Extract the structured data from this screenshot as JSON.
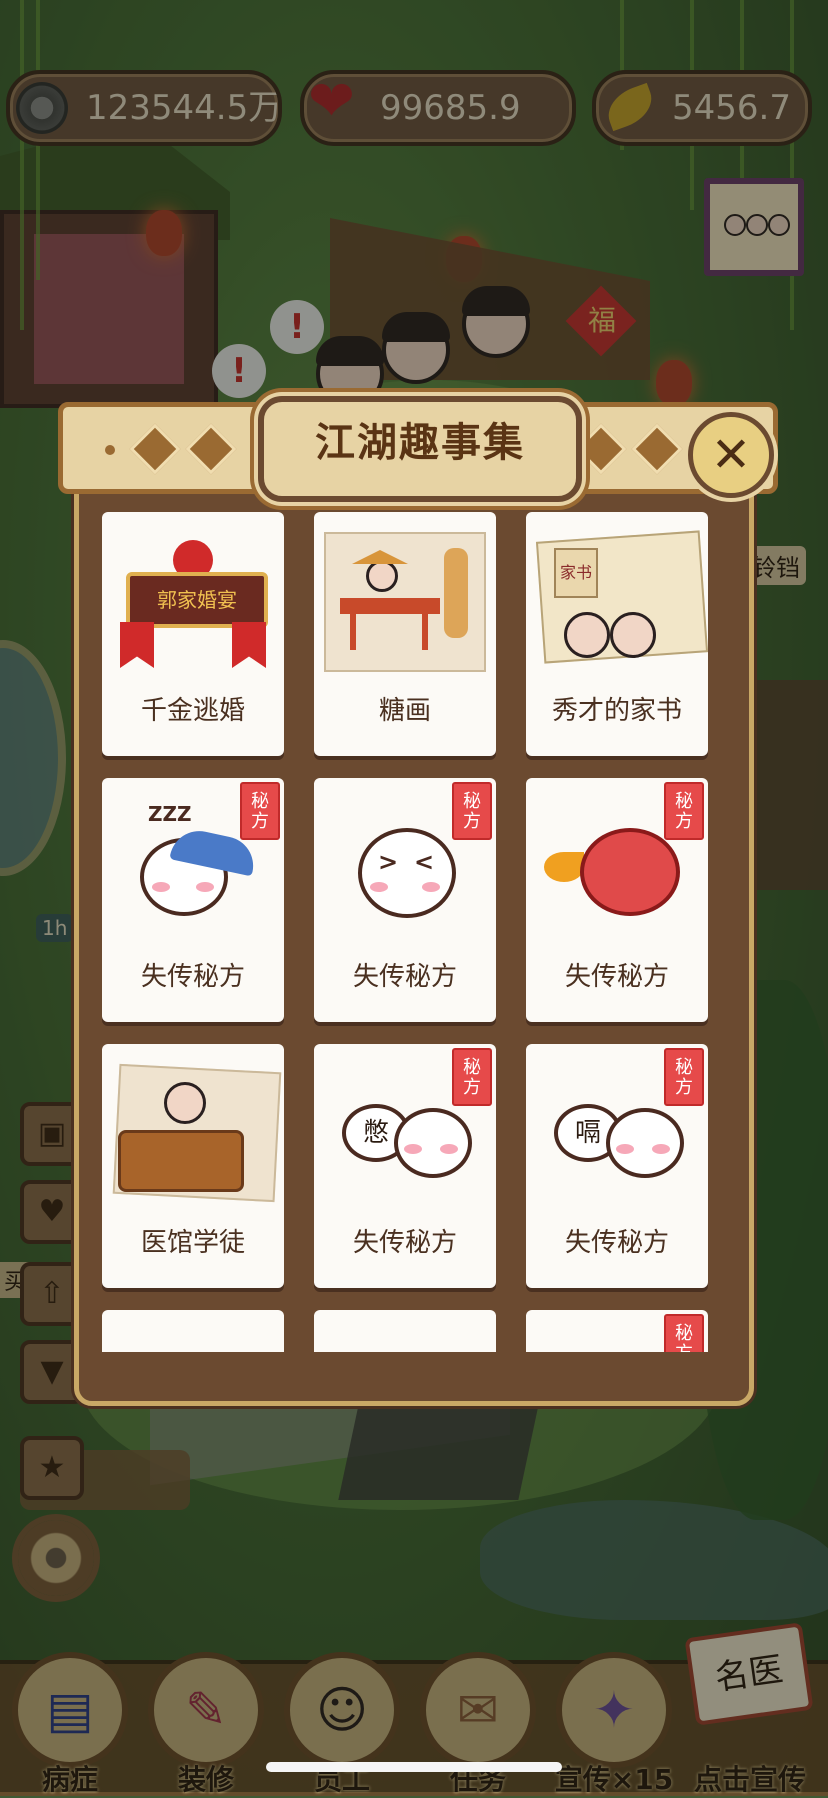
{
  "resources": {
    "coins": "123544.5万",
    "hearts": "99685.9",
    "leaves": "5456.7"
  },
  "modal": {
    "title": "江湖趣事集",
    "close_symbol": "✕",
    "cards": [
      {
        "label": "千金逃婚",
        "art": "wedding-sign",
        "secret": false
      },
      {
        "label": "糖画",
        "art": "sugar-painting",
        "secret": false
      },
      {
        "label": "秀才的家书",
        "art": "family-letter",
        "secret": false
      },
      {
        "label": "失传秘方",
        "art": "sleepy-bun",
        "secret": true
      },
      {
        "label": "失传秘方",
        "art": "crying-bun",
        "secret": true
      },
      {
        "label": "失传秘方",
        "art": "fire-bun",
        "secret": true
      },
      {
        "label": "医馆学徒",
        "art": "clinic-apprentice",
        "secret": false
      },
      {
        "label": "失传秘方",
        "art": "sweating-bun",
        "secret": true
      },
      {
        "label": "失传秘方",
        "art": "speechless-bun",
        "secret": true
      }
    ],
    "seal_text": [
      "秘",
      "方"
    ],
    "wedding_sign_text": "郭家婚宴",
    "letter_text": "家书",
    "bubble_words": {
      "sweating": "憋",
      "speechless": "嗝"
    },
    "sleep_text": "ZZZ"
  },
  "scene": {
    "side_labels": {
      "timer": "1h",
      "buy": "买",
      "bell_sign": "铃铛"
    },
    "fu": "福",
    "alert": "!"
  },
  "bottom_menu": [
    {
      "label": "病症",
      "icon": "book-icon"
    },
    {
      "label": "装修",
      "icon": "brush-icon"
    },
    {
      "label": "员工",
      "icon": "staff-icon"
    },
    {
      "label": "任务",
      "icon": "scroll-icon"
    },
    {
      "label": "宣传×15",
      "icon": "promo-icon"
    },
    {
      "label": "点击宣传",
      "icon": "famous-doctor-icon"
    }
  ],
  "famous_doctor_sign": "名医"
}
